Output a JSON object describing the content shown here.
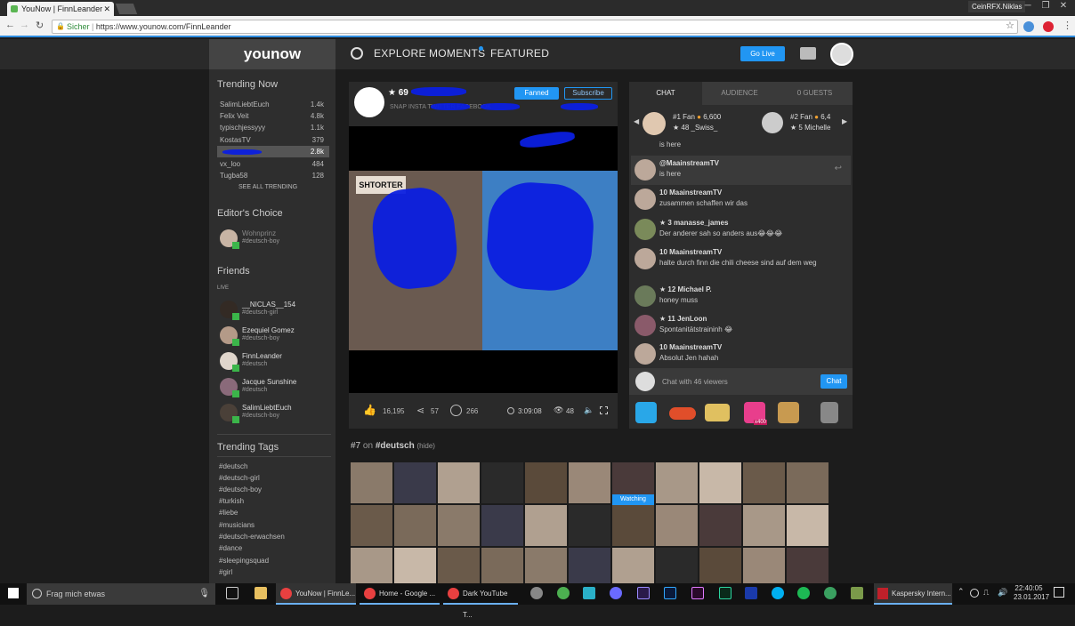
{
  "browser": {
    "tabs": [
      {
        "title": "YouNow | FinnLeander"
      }
    ],
    "user_button": "CeinRFX.Niklas",
    "secure_label": "Sicher",
    "url": "https://www.younow.com/FinnLeander"
  },
  "topnav": {
    "logo": "younow",
    "links": [
      "EXPLORE",
      "MOMENTS",
      "FEATURED"
    ],
    "go_live": "Go Live"
  },
  "sidebar": {
    "trending_now": {
      "title": "Trending Now",
      "items": [
        {
          "name": "SalimLiebtEuch",
          "count": "1.4k"
        },
        {
          "name": "Felix Veit",
          "count": "4.8k"
        },
        {
          "name": "typischjessyyy",
          "count": "1.1k"
        },
        {
          "name": "KostasTV",
          "count": "379"
        },
        {
          "name": "",
          "count": "2.8k"
        },
        {
          "name": "vx_loo",
          "count": "484"
        },
        {
          "name": "Tugba58",
          "count": "128"
        }
      ],
      "see_all": "SEE ALL TRENDING"
    },
    "editors_choice": {
      "title": "Editor's Choice",
      "items": [
        {
          "name": "Wohnprinz",
          "tag": "#deutsch-boy"
        }
      ]
    },
    "friends": {
      "title": "Friends",
      "live_label": "LIVE",
      "items": [
        {
          "name": "__NICLAS__154",
          "tag": "#deutsch-girl"
        },
        {
          "name": "Ezequiel Gomez",
          "tag": "#deutsch-boy"
        },
        {
          "name": "FinnLeander",
          "tag": "#deutsch"
        },
        {
          "name": "Jacque Sunshine",
          "tag": "#deutsch"
        },
        {
          "name": "SalimLiebtEuch",
          "tag": "#deutsch-boy"
        }
      ]
    },
    "trending_tags": {
      "title": "Trending Tags",
      "tags": [
        "#deutsch",
        "#deutsch-girl",
        "#deutsch-boy",
        "#turkish",
        "#liebe",
        "#musicians",
        "#deutsch-erwachsen",
        "#dance",
        "#sleepingsquad",
        "#girl"
      ]
    }
  },
  "broadcast": {
    "level": "★ 69",
    "fanned": "Fanned",
    "subscribe": "Subscribe",
    "social": "SNAP INSTA TWITTER FACEBOOK",
    "likes": "16,195",
    "shares": "57",
    "views": "266",
    "duration": "3:09:08",
    "viewers": "48"
  },
  "chat": {
    "tabs": [
      "CHAT",
      "AUDIENCE",
      "0 GUESTS"
    ],
    "fan1": {
      "rank": "#1 Fan",
      "value": "6,600",
      "user": "★ 48 _Swiss_"
    },
    "fan2": {
      "rank": "#2 Fan",
      "value": "6,4",
      "user": "★ 5 Michelle"
    },
    "partial_top": "is here",
    "messages": [
      {
        "user": "@MaainstreamTV",
        "text": "is here"
      },
      {
        "user": "10 MaainstreamTV",
        "text": "zusammen schaffen wir das"
      },
      {
        "user": "★ 3 manasse_james",
        "text": "Der anderer sah so anders aus😂😂😂"
      },
      {
        "user": "10 MaainstreamTV",
        "text": "halte durch finn die chili cheese sind auf dem weg"
      },
      {
        "user": "★ 12 Michael P.",
        "text": "honey muss"
      },
      {
        "user": "★ 11 JenLoon",
        "text": "Spontanitätstraininh 😂"
      },
      {
        "user": "10 MaainstreamTV",
        "text": "Absolut Jen hahah"
      }
    ],
    "input_placeholder": "Chat with 46 viewers",
    "send": "Chat",
    "gift_badge": "x400"
  },
  "tag_section": {
    "rank": "#7",
    "on": "on",
    "tag": "#deutsch",
    "hide": "(hide)",
    "watching": "Watching"
  },
  "video": {
    "poster_top": "SHTORTER"
  },
  "taskbar": {
    "search": "Frag mich etwas",
    "apps": [
      "YouNow | FinnLe...",
      "Home - Google ...",
      "Dark YouTube T...",
      "Kaspersky Intern..."
    ],
    "time": "22:40:05",
    "date": "23.01.2017"
  },
  "colors": {
    "accent": "#2196f3",
    "live_green": "#3bb54a",
    "scribble": "#0b1fe0"
  }
}
